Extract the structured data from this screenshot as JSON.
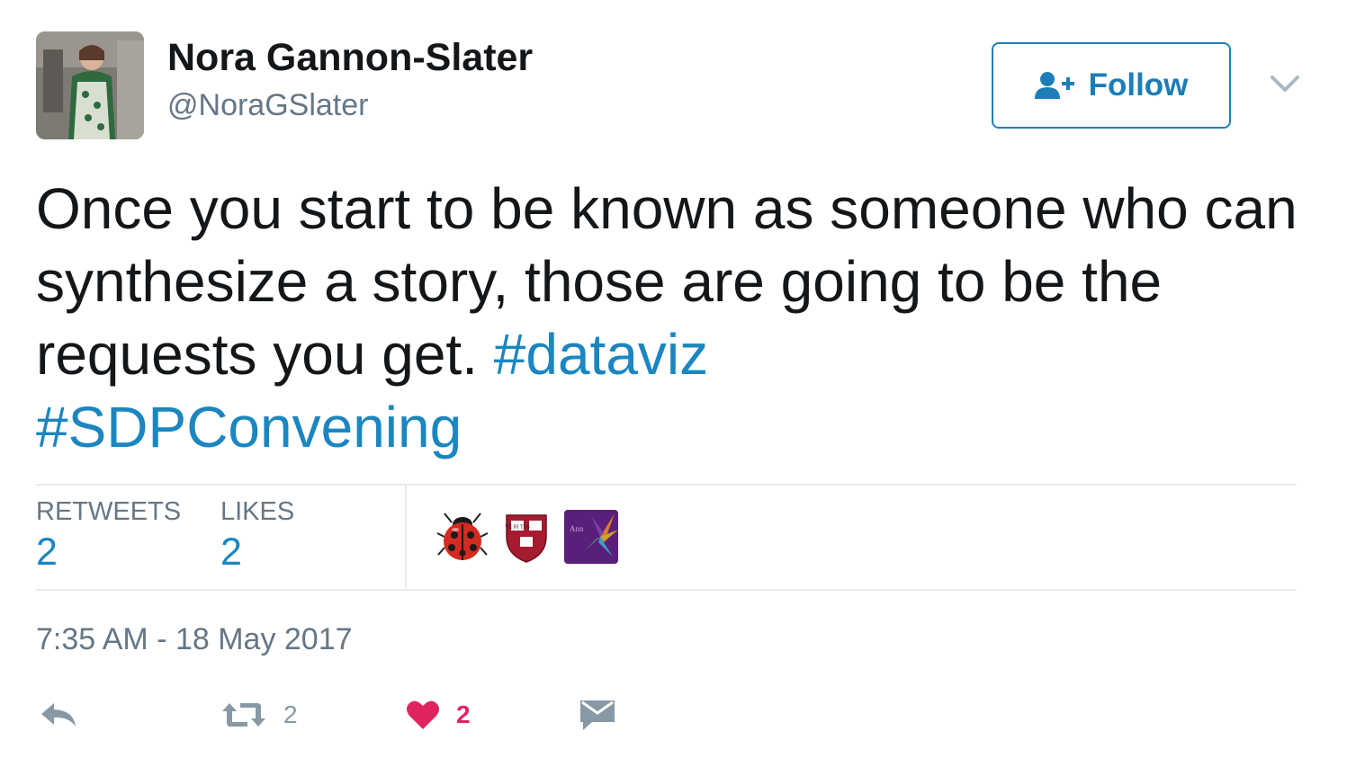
{
  "user": {
    "display_name": "Nora Gannon-Slater",
    "handle": "@NoraGSlater"
  },
  "follow_button": {
    "label": "Follow",
    "icon": "add-user-icon"
  },
  "tweet": {
    "text": "Once you start to be known as someone who can synthesize a story, those are going to be the requests you get.",
    "hashtags": [
      "#dataviz",
      "#SDPConvening"
    ]
  },
  "stats": {
    "retweets_label": "RETWEETS",
    "retweets_count": "2",
    "likes_label": "LIKES",
    "likes_count": "2",
    "likers": [
      {
        "icon": "ladybug-icon"
      },
      {
        "icon": "harvard-shield-icon",
        "text": "VE RI TAS"
      },
      {
        "icon": "purple-leaf-avatar-icon",
        "text": "Ann"
      }
    ]
  },
  "timestamp": "7:35 AM - 18 May 2017",
  "actions": {
    "reply_icon": "reply-icon",
    "retweet_icon": "retweet-icon",
    "retweet_count": "2",
    "like_icon": "heart-icon",
    "like_count": "2",
    "dm_icon": "envelope-icon"
  },
  "colors": {
    "link": "#1b86c0",
    "like": "#e0245e",
    "muted": "#657786"
  }
}
